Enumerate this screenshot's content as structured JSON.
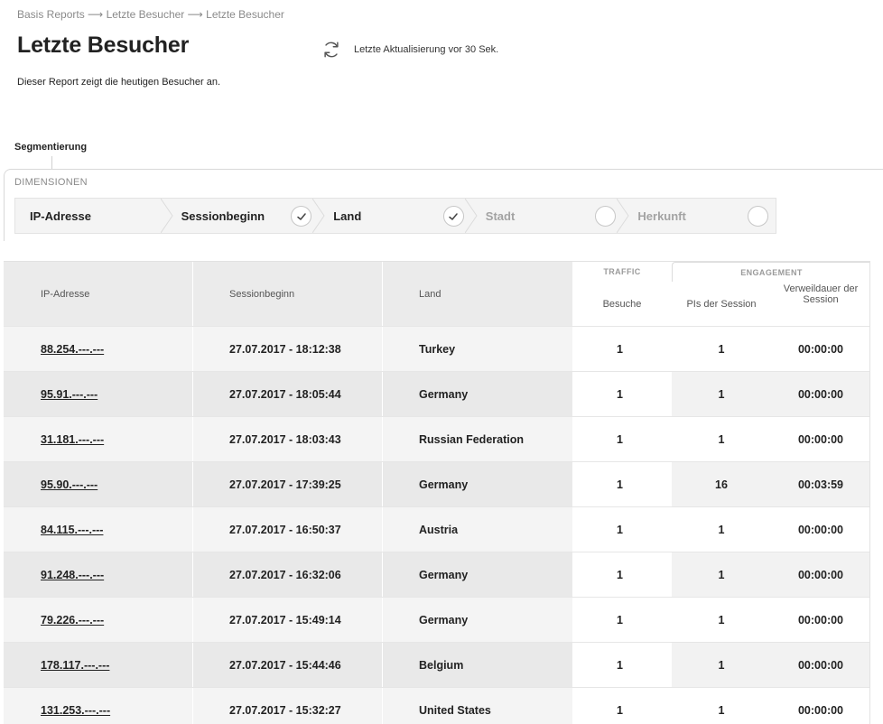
{
  "breadcrumb": "Basis Reports ⟶ Letzte Besucher ⟶ Letzte Besucher",
  "page_title": "Letzte Besucher",
  "refresh": {
    "icon": "refresh-icon",
    "text": "Letzte Aktualisierung vor 30 Sek."
  },
  "description": "Dieser Report zeigt die heutigen Besucher an.",
  "segmentation": {
    "title": "Segmentierung",
    "dimensions_label": "DIMENSIONEN",
    "dimensions": [
      {
        "label": "IP-Adresse",
        "state": "none"
      },
      {
        "label": "Sessionbeginn",
        "state": "checked"
      },
      {
        "label": "Land",
        "state": "checked"
      },
      {
        "label": "Stadt",
        "state": "unchecked"
      },
      {
        "label": "Herkunft",
        "state": "unchecked"
      }
    ]
  },
  "table": {
    "columns": {
      "ip": "IP-Adresse",
      "session_start": "Sessionbeginn",
      "country": "Land",
      "visits": "Besuche",
      "pis": "PIs der Session",
      "duration": "Verweildauer der Session"
    },
    "groups": {
      "traffic": "TRAFFIC",
      "engagement": "ENGAGEMENT"
    },
    "rows": [
      {
        "ip": "88.254.---.---",
        "session_start": "27.07.2017 - 18:12:38",
        "country": "Turkey",
        "visits": "1",
        "pis": "1",
        "duration": "00:00:00"
      },
      {
        "ip": "95.91.---.---",
        "session_start": "27.07.2017 - 18:05:44",
        "country": "Germany",
        "visits": "1",
        "pis": "1",
        "duration": "00:00:00"
      },
      {
        "ip": "31.181.---.---",
        "session_start": "27.07.2017 - 18:03:43",
        "country": "Russian Federation",
        "visits": "1",
        "pis": "1",
        "duration": "00:00:00"
      },
      {
        "ip": "95.90.---.---",
        "session_start": "27.07.2017 - 17:39:25",
        "country": "Germany",
        "visits": "1",
        "pis": "16",
        "duration": "00:03:59"
      },
      {
        "ip": "84.115.---.---",
        "session_start": "27.07.2017 - 16:50:37",
        "country": "Austria",
        "visits": "1",
        "pis": "1",
        "duration": "00:00:00"
      },
      {
        "ip": "91.248.---.---",
        "session_start": "27.07.2017 - 16:32:06",
        "country": "Germany",
        "visits": "1",
        "pis": "1",
        "duration": "00:00:00"
      },
      {
        "ip": "79.226.---.---",
        "session_start": "27.07.2017 - 15:49:14",
        "country": "Germany",
        "visits": "1",
        "pis": "1",
        "duration": "00:00:00"
      },
      {
        "ip": "178.117.---.---",
        "session_start": "27.07.2017 - 15:44:46",
        "country": "Belgium",
        "visits": "1",
        "pis": "1",
        "duration": "00:00:00"
      },
      {
        "ip": "131.253.---.---",
        "session_start": "27.07.2017 - 15:32:27",
        "country": "United States",
        "visits": "1",
        "pis": "1",
        "duration": "00:00:00"
      }
    ]
  }
}
